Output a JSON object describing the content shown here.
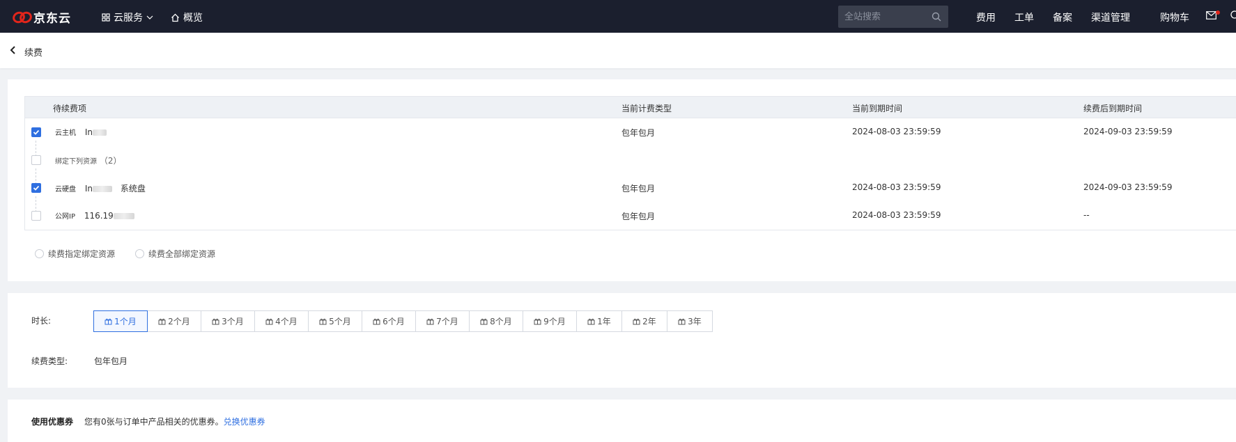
{
  "brand": {
    "name": "京东云",
    "color": "#e1251b"
  },
  "topnav": {
    "cloud_services": "云服务",
    "overview": "概览",
    "search_placeholder": "全站搜索",
    "links": [
      "费用",
      "工单",
      "备案",
      "渠道管理",
      "购物车"
    ]
  },
  "page": {
    "back_label": "续费"
  },
  "table": {
    "headers": [
      "待续费项",
      "当前计费类型",
      "当前到期时间",
      "续费后到期时间"
    ],
    "rows": [
      {
        "checked": true,
        "type": "云主机",
        "name": "In",
        "billing": "包年包月",
        "expire": "2024-08-03 23:59:59",
        "renew_expire": "2024-09-03 23:59:59"
      },
      {
        "checked": false,
        "bind_label": "绑定下列资源",
        "bind_count": "（2）"
      },
      {
        "checked": true,
        "type": "云硬盘",
        "name": "In",
        "suffix": "系统盘",
        "billing": "包年包月",
        "expire": "2024-08-03 23:59:59",
        "renew_expire": "2024-09-03 23:59:59"
      },
      {
        "checked": false,
        "type": "公网IP",
        "name": "116.19",
        "billing": "包年包月",
        "expire": "2024-08-03 23:59:59",
        "renew_expire": "--"
      }
    ]
  },
  "renew_options": [
    "续费指定绑定资源",
    "续费全部绑定资源"
  ],
  "duration": {
    "label": "时长:",
    "options": [
      "1个月",
      "2个月",
      "3个月",
      "4个月",
      "5个月",
      "6个月",
      "7个月",
      "8个月",
      "9个月",
      "1年",
      "2年",
      "3年"
    ],
    "selected_index": 0
  },
  "renew_type": {
    "label": "续费类型:",
    "value": "包年包月"
  },
  "coupon": {
    "title": "使用优惠券",
    "text": "您有0张与订单中产品相关的优惠券。",
    "link": "兑换优惠券"
  },
  "colors": {
    "accent": "#2f6fe0",
    "topbar": "#1b1f2e"
  }
}
